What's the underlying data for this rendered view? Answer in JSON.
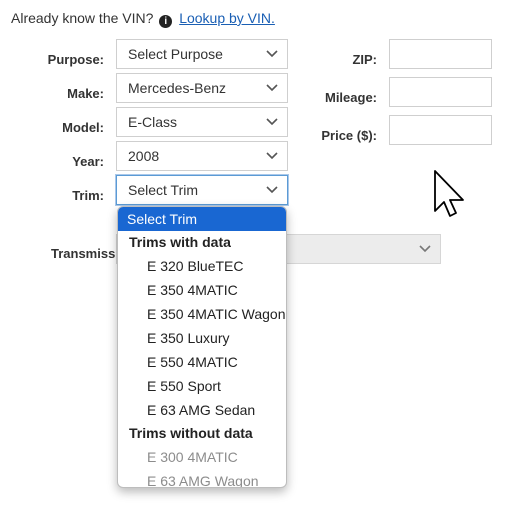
{
  "vin": {
    "prompt": "Already know the VIN?",
    "info_icon": "info-circle-icon",
    "link": "Lookup by VIN."
  },
  "form": {
    "purpose": {
      "label": "Purpose:",
      "value": "Select Purpose"
    },
    "make": {
      "label": "Make:",
      "value": "Mercedes-Benz"
    },
    "model": {
      "label": "Model:",
      "value": "E-Class"
    },
    "year": {
      "label": "Year:",
      "value": "2008"
    },
    "trim": {
      "label": "Trim:",
      "value": "Select Trim"
    },
    "transmission": {
      "label": "Transmissio",
      "value": ""
    },
    "zip": {
      "label": "ZIP:",
      "value": ""
    },
    "mileage": {
      "label": "Mileage:",
      "value": ""
    },
    "price": {
      "label": "Price ($):",
      "value": ""
    }
  },
  "trim_dropdown": {
    "selected": "Select Trim",
    "groups": [
      {
        "label": "Trims with data",
        "options": [
          "E 320 BlueTEC",
          "E 350 4MATIC",
          "E 350 4MATIC Wagon",
          "E 350 Luxury",
          "E 550 4MATIC",
          "E 550 Sport",
          "E 63 AMG Sedan"
        ]
      },
      {
        "label": "Trims without data",
        "options": [
          "E 300 4MATIC",
          "E 63 AMG Wagon"
        ]
      }
    ]
  },
  "icons": {
    "chevron": "chevron-down-icon",
    "pointer": "mouse-pointer-icon"
  }
}
